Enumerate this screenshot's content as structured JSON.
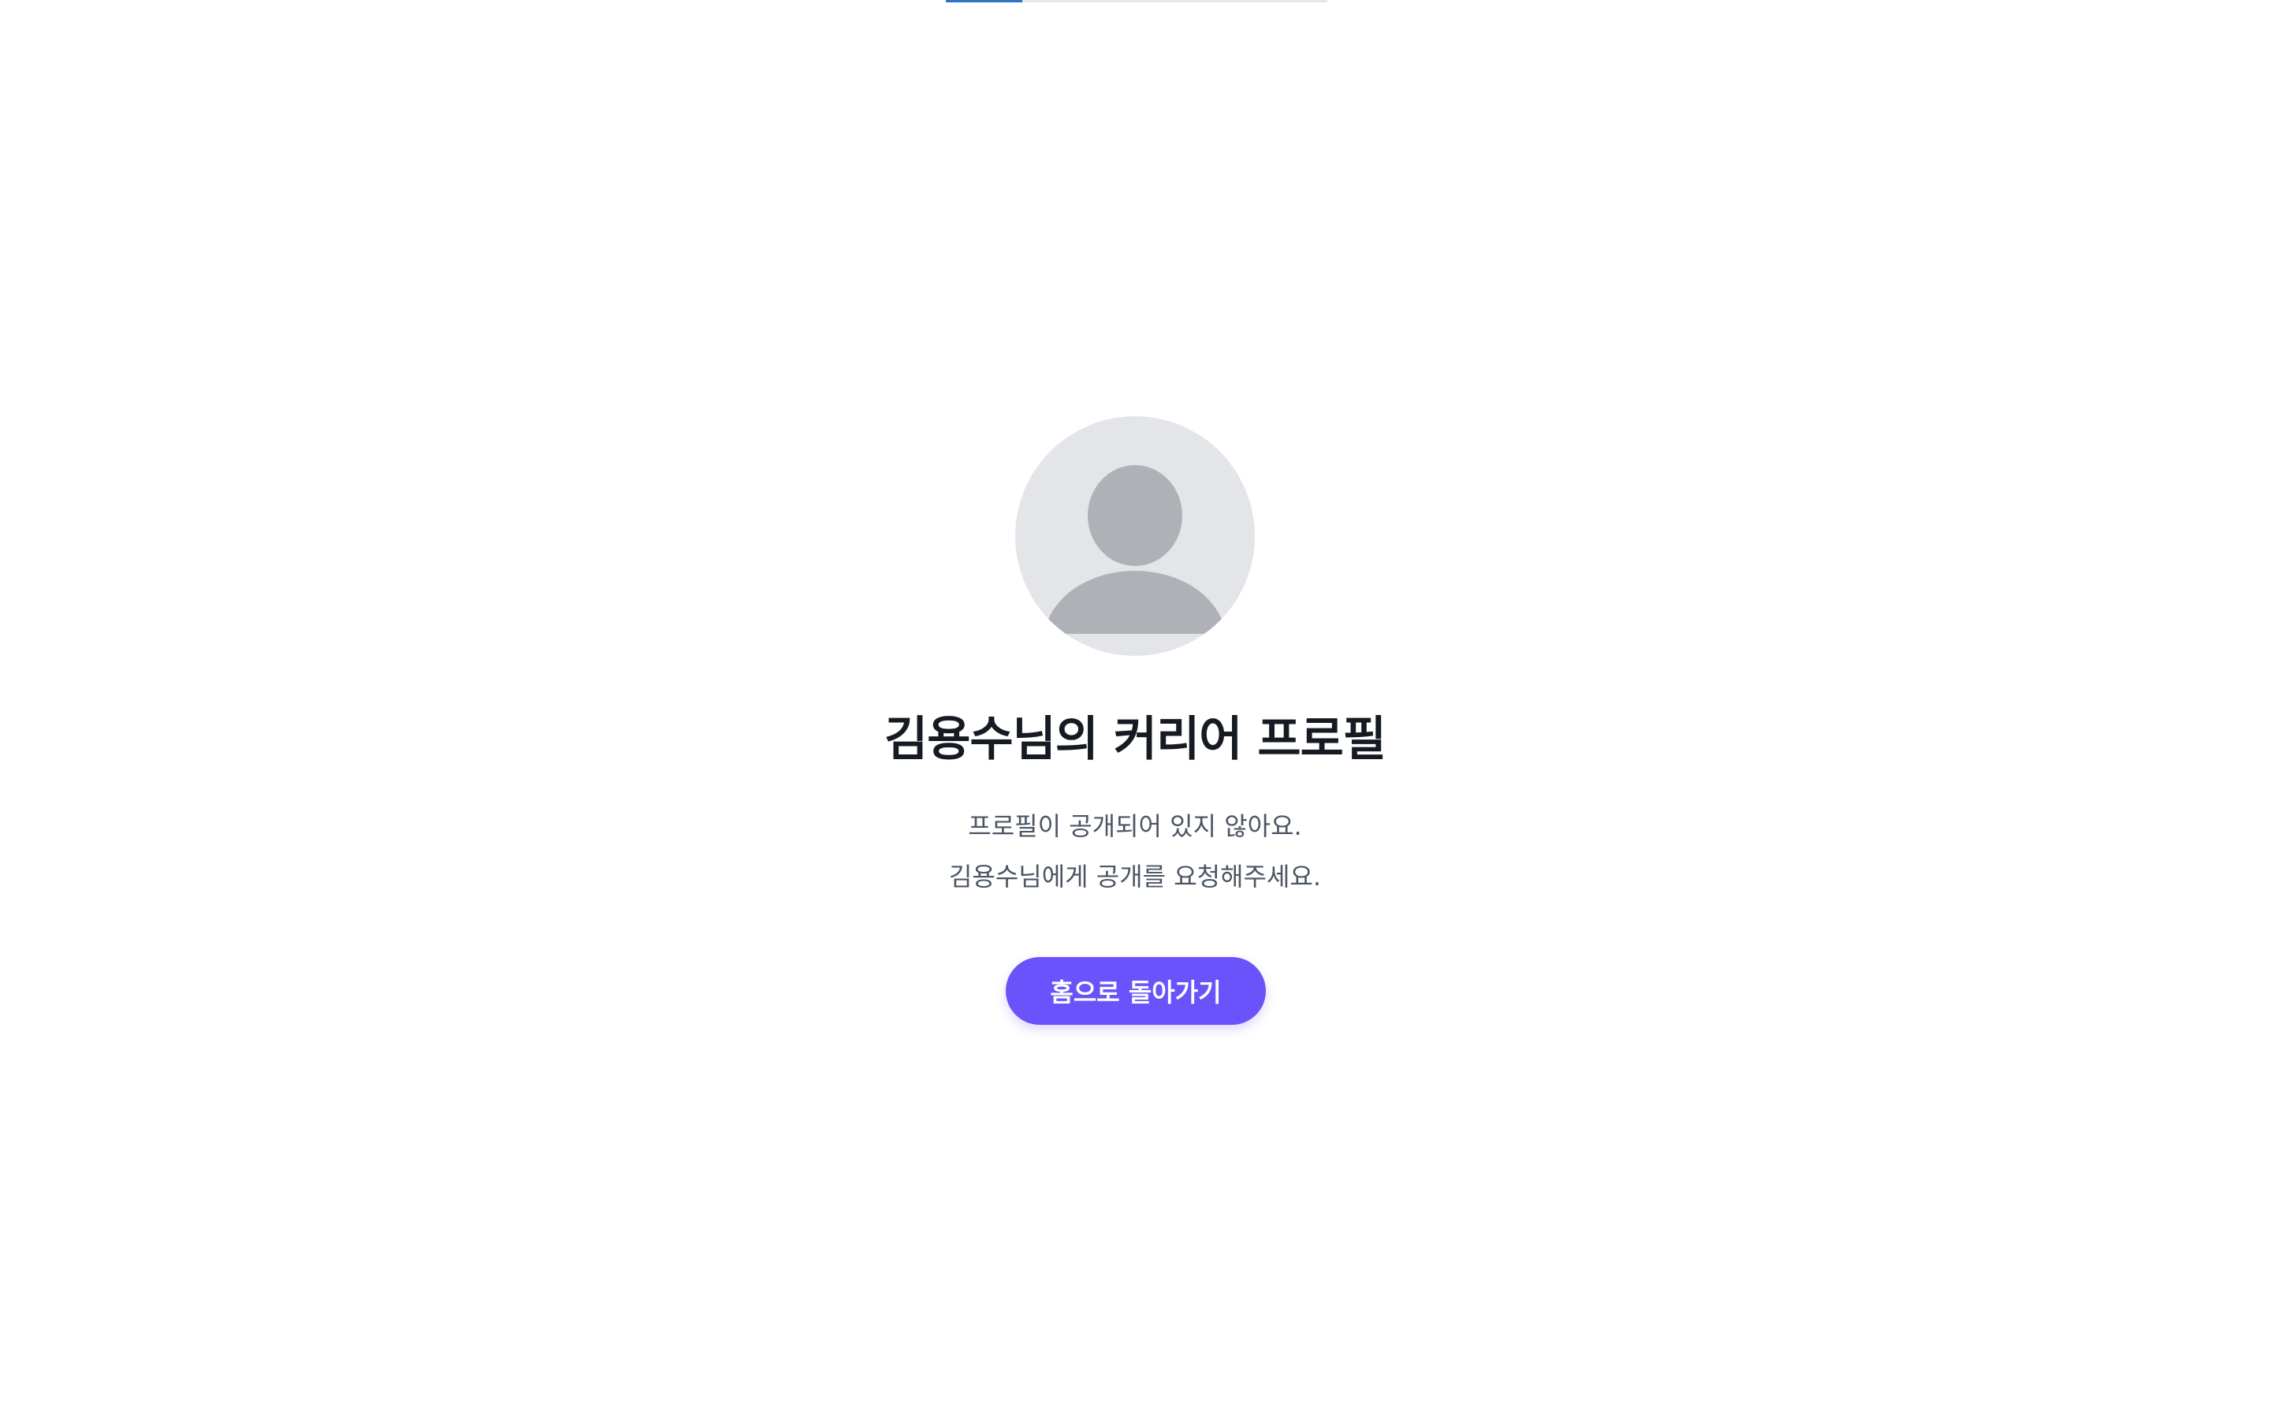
{
  "top_progress": {
    "fill_fraction": 0.2
  },
  "avatar": {
    "icon": "default-user-icon"
  },
  "profile": {
    "title": "김용수님의 커리어 프로필",
    "message_line1": "프로필이 공개되어 있지 않아요.",
    "message_line2": "김용수님에게 공개를 요청해주세요."
  },
  "actions": {
    "home_button_label": "홈으로 돌아가기"
  },
  "colors": {
    "accent": "#6b53fb",
    "progress": "#2b74c7",
    "avatar_bg": "#e4e5e8",
    "avatar_icon": "#aeb2b7",
    "title": "#161a22",
    "body_text": "#4b5563"
  }
}
